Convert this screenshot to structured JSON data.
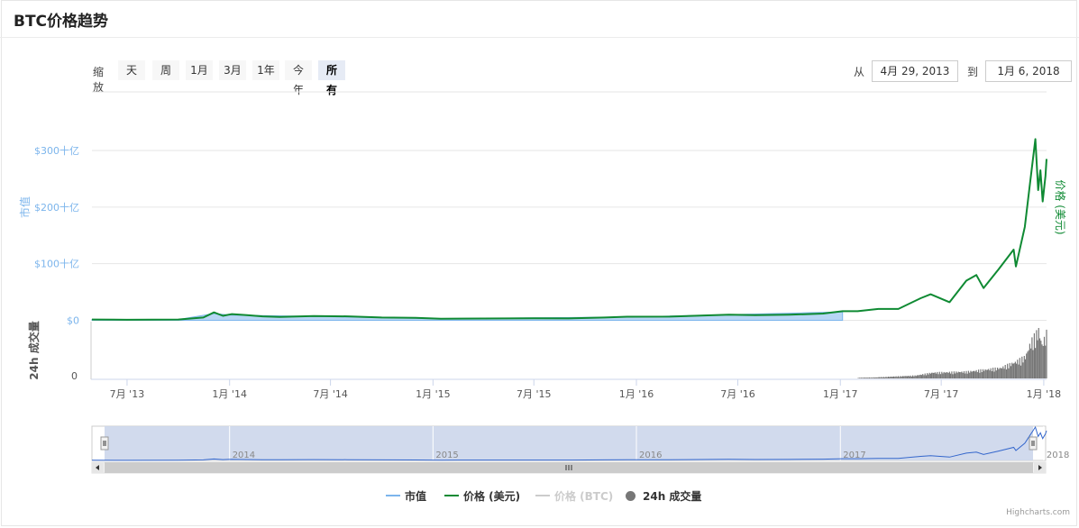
{
  "page": {
    "title": "BTC价格趋势"
  },
  "range_selector": {
    "zoom_label": "缩放",
    "buttons": [
      "天",
      "周",
      "1月",
      "3月",
      "1年",
      "今年",
      "所有"
    ],
    "active_index": 6,
    "from_label": "从",
    "to_label": "到",
    "from_value": "4月 29, 2013",
    "to_value": "1月 6, 2018"
  },
  "legend": {
    "items": [
      {
        "label": "市值",
        "color": "#7cb5ec",
        "symbol": "line",
        "visible": true
      },
      {
        "label": "价格 (美元)",
        "color": "#0f8a33",
        "symbol": "line",
        "visible": true
      },
      {
        "label": "价格 (BTC)",
        "color": "#cccccc",
        "symbol": "line",
        "visible": false
      },
      {
        "label": "24h 成交量",
        "color": "#777777",
        "symbol": "circle",
        "visible": true
      }
    ]
  },
  "credits": "Highcharts.com",
  "colors": {
    "market_cap": "#7cb5ec",
    "price_usd": "#0f8a33",
    "volume": "#777777",
    "navigator_mask": "#ccd6eb"
  },
  "chart_data": {
    "type": "line",
    "title": "BTC价格趋势",
    "xlabel": "",
    "x_tick_labels": [
      "7月 '13",
      "1月 '14",
      "7月 '14",
      "1月 '15",
      "7月 '15",
      "1月 '16",
      "7月 '16",
      "1月 '17",
      "7月 '17",
      "1月 '18"
    ],
    "x_range": [
      "2013-04-29",
      "2018-01-06"
    ],
    "y_left": {
      "label": "市值",
      "ticks": [
        "$0",
        "$100十亿",
        "$200十亿",
        "$300十亿"
      ],
      "tick_values": [
        0,
        100,
        200,
        300
      ],
      "unit": "十亿美元"
    },
    "y_right": {
      "label": "价格 (美元)"
    },
    "volume_axis": {
      "label": "24h 成交量",
      "ticks": [
        "0"
      ]
    },
    "series": [
      {
        "name": "价格 (美元)",
        "axis": "left",
        "note_units": "market cap equivalent, 十亿美元",
        "points": [
          [
            "2013-04-29",
            1.5
          ],
          [
            "2013-07-01",
            1.0
          ],
          [
            "2013-10-01",
            1.5
          ],
          [
            "2013-11-15",
            5
          ],
          [
            "2013-12-04",
            14
          ],
          [
            "2013-12-20",
            8
          ],
          [
            "2014-01-05",
            11
          ],
          [
            "2014-02-01",
            9
          ],
          [
            "2014-03-01",
            7
          ],
          [
            "2014-04-01",
            6
          ],
          [
            "2014-06-01",
            7.5
          ],
          [
            "2014-08-01",
            7
          ],
          [
            "2014-10-01",
            5
          ],
          [
            "2014-12-01",
            4.5
          ],
          [
            "2015-01-15",
            2.8
          ],
          [
            "2015-04-01",
            3.2
          ],
          [
            "2015-07-01",
            3.6
          ],
          [
            "2015-09-01",
            3.4
          ],
          [
            "2015-11-05",
            5
          ],
          [
            "2015-12-15",
            6.3
          ],
          [
            "2016-03-01",
            6.5
          ],
          [
            "2016-06-15",
            10
          ],
          [
            "2016-08-01",
            9
          ],
          [
            "2016-10-01",
            9.8
          ],
          [
            "2016-12-01",
            12
          ],
          [
            "2017-01-05",
            16
          ],
          [
            "2017-02-01",
            16
          ],
          [
            "2017-03-10",
            20
          ],
          [
            "2017-04-15",
            20
          ],
          [
            "2017-05-25",
            39
          ],
          [
            "2017-06-12",
            46
          ],
          [
            "2017-07-16",
            32
          ],
          [
            "2017-08-15",
            70
          ],
          [
            "2017-09-02",
            80
          ],
          [
            "2017-09-15",
            57
          ],
          [
            "2017-10-12",
            90
          ],
          [
            "2017-11-08",
            125
          ],
          [
            "2017-11-12",
            95
          ],
          [
            "2017-11-28",
            165
          ],
          [
            "2017-12-07",
            240
          ],
          [
            "2017-12-17",
            320
          ],
          [
            "2017-12-22",
            230
          ],
          [
            "2017-12-26",
            265
          ],
          [
            "2017-12-30",
            210
          ],
          [
            "2018-01-04",
            255
          ],
          [
            "2018-01-06",
            285
          ]
        ]
      },
      {
        "name": "市值",
        "axis": "left",
        "points": [
          [
            "2013-04-29",
            1.5
          ],
          [
            "2013-10-01",
            1.5
          ],
          [
            "2013-12-04",
            12
          ],
          [
            "2014-01-05",
            9
          ],
          [
            "2014-06-01",
            7
          ],
          [
            "2015-01-15",
            2.8
          ],
          [
            "2016-01-01",
            6
          ],
          [
            "2017-01-05",
            15
          ]
        ]
      },
      {
        "name": "24h 成交量",
        "axis": "volume",
        "note": "relative 0-1 scale of lower panel",
        "points": [
          [
            "2013-04-29",
            0
          ],
          [
            "2016-12-01",
            0
          ],
          [
            "2017-03-01",
            0.02
          ],
          [
            "2017-05-15",
            0.06
          ],
          [
            "2017-06-15",
            0.12
          ],
          [
            "2017-08-15",
            0.14
          ],
          [
            "2017-09-15",
            0.18
          ],
          [
            "2017-10-15",
            0.22
          ],
          [
            "2017-11-12",
            0.35
          ],
          [
            "2017-11-28",
            0.45
          ],
          [
            "2017-12-08",
            0.75
          ],
          [
            "2017-12-17",
            0.9
          ],
          [
            "2017-12-22",
            1.0
          ],
          [
            "2017-12-28",
            0.7
          ],
          [
            "2018-01-06",
            0.95
          ]
        ]
      }
    ],
    "navigator": {
      "labels": [
        "2014",
        "2015",
        "2016",
        "2017",
        "2018"
      ],
      "selected_range": [
        "2013-04-29",
        "2018-01-06"
      ]
    },
    "grid": true,
    "legend_position": "bottom"
  }
}
